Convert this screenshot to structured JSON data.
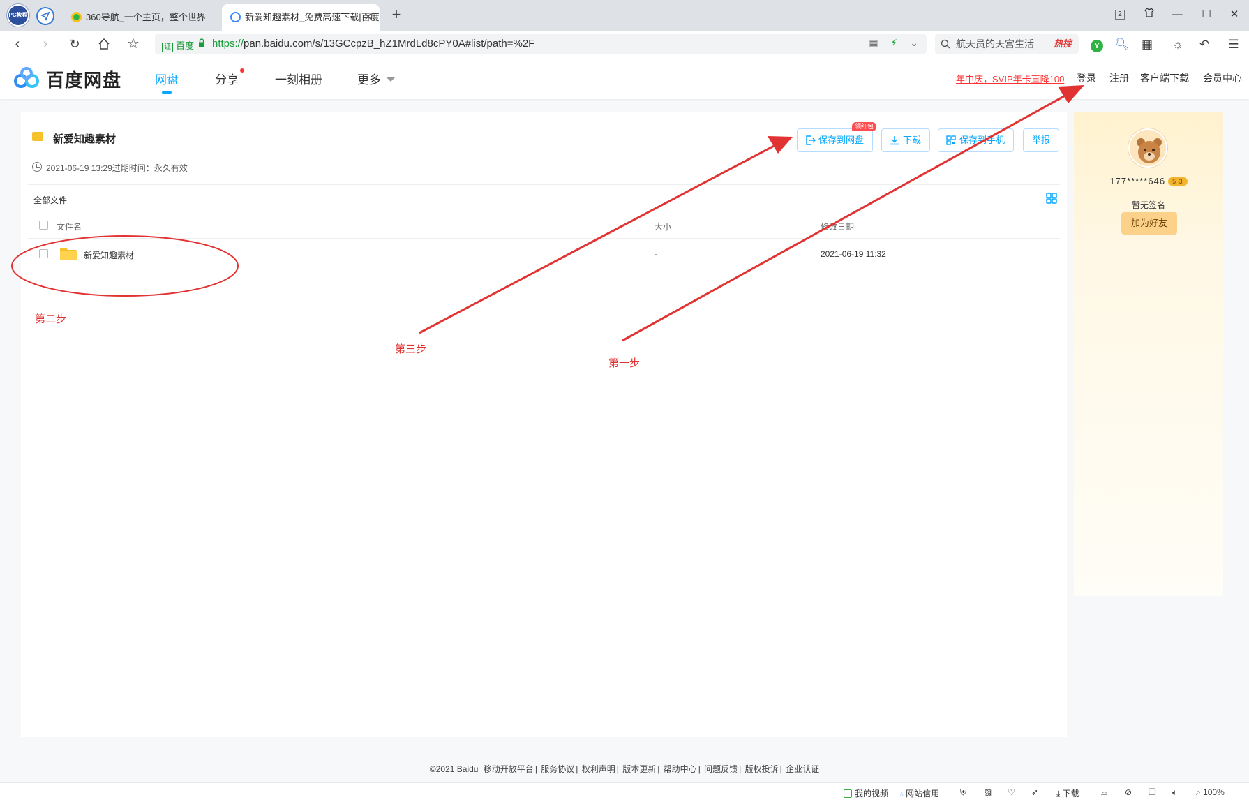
{
  "browser": {
    "badge_text": "PC教程",
    "tabs": [
      {
        "label": "360导航_一个主页，整个世界",
        "active": false
      },
      {
        "label": "新爱知趣素材_免费高速下载|百度",
        "active": true
      }
    ],
    "new_tab": "+",
    "window_badge": "2",
    "url": {
      "cert_label": "百度",
      "scheme": "https://",
      "rest": "pan.baidu.com/s/13GCcpzB_hZ1MrdLd8cPY0A#list/path=%2F"
    },
    "search": {
      "text": "航天员的天宫生活",
      "hot": "热搜"
    }
  },
  "header": {
    "logo_text": "百度网盘",
    "nav": [
      {
        "label": "网盘",
        "active": true
      },
      {
        "label": "分享",
        "active": false,
        "dot": true
      },
      {
        "label": "一刻相册",
        "active": false
      },
      {
        "label": "更多",
        "active": false,
        "caret": true
      }
    ],
    "promo": "年中庆，SVIP年卡直降100",
    "links": [
      "登录",
      "注册",
      "客户端下载",
      "会员中心"
    ]
  },
  "share": {
    "title": "新爱知趣素材",
    "meta": "2021-06-19 13:29过期时间：永久有效",
    "buttons": {
      "save": "保存到网盘",
      "save_badge": "领红包",
      "download": "下载",
      "save_phone": "保存到手机",
      "report": "举报"
    },
    "breadcrumb": "全部文件",
    "columns": {
      "name": "文件名",
      "size": "大小",
      "date": "修改日期"
    },
    "rows": [
      {
        "name": "新爱知趣素材",
        "size": "-",
        "date": "2021-06-19 11:32"
      }
    ]
  },
  "user_panel": {
    "username": "177*****646",
    "level": "5",
    "level_num": "3",
    "signature": "暂无签名",
    "add_friend": "加为好友"
  },
  "annotations": {
    "step1": "第一步",
    "step2": "第二步",
    "step3": "第三步",
    "color": "#e23333"
  },
  "footer": {
    "items": [
      "©2021 Baidu",
      "移动开放平台",
      "服务协议",
      "权利声明",
      "版本更新",
      "帮助中心",
      "问题反馈",
      "版权投诉",
      "企业认证"
    ]
  },
  "statusbar": {
    "video": "我的视频",
    "credit": "网站信用",
    "download": "下载",
    "zoom": "100%"
  },
  "colors": {
    "accent": "#06a7ff",
    "promo": "#ff3333"
  }
}
